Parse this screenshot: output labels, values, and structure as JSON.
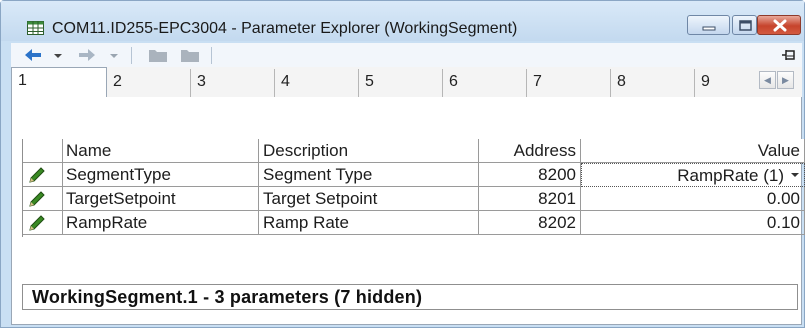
{
  "window": {
    "title": "COM11.ID255-EPC3004 - Parameter Explorer (WorkingSegment)",
    "icon": "grid-table-icon",
    "controls": [
      "minimize-icon",
      "maximize-icon",
      "close-icon"
    ]
  },
  "toolbar": {
    "items": [
      "back-arrow-icon",
      "back-dropdown-icon",
      "forward-arrow-icon",
      "forward-dropdown-icon",
      "folder-icon",
      "folder-icon",
      "pin-icon"
    ]
  },
  "tabs": [
    "1",
    "2",
    "3",
    "4",
    "5",
    "6",
    "7",
    "8",
    "9"
  ],
  "active_tab": "1",
  "table": {
    "columns": [
      "Name",
      "Description",
      "Address",
      "Value"
    ],
    "rows": [
      {
        "name": "SegmentType",
        "description": "Segment Type",
        "address": "8200",
        "value": "RampRate (1)"
      },
      {
        "name": "TargetSetpoint",
        "description": "Target Setpoint",
        "address": "8201",
        "value": "0.00"
      },
      {
        "name": "RampRate",
        "description": "Ramp Rate",
        "address": "8202",
        "value": "0.10"
      }
    ]
  },
  "status": "WorkingSegment.1  -  3 parameters (7 hidden)",
  "colors": {
    "window_frame": "#c9dff3",
    "close_button": "#c6442c",
    "pencil_icon": "#2e7d1a"
  }
}
